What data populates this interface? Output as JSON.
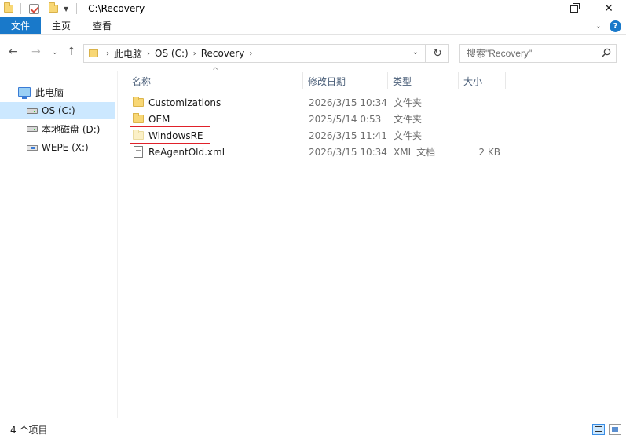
{
  "window": {
    "title": "C:\\Recovery"
  },
  "ribbon": {
    "tabs": [
      "文件",
      "主页",
      "查看"
    ]
  },
  "navigation": {
    "breadcrumb": [
      "此电脑",
      "OS (C:)",
      "Recovery"
    ],
    "search_placeholder": "搜索\"Recovery\""
  },
  "sidebar": {
    "items": [
      {
        "label": "此电脑",
        "icon": "computer-icon"
      },
      {
        "label": "OS (C:)",
        "icon": "drive-icon",
        "selected": true
      },
      {
        "label": "本地磁盘 (D:)",
        "icon": "drive-icon"
      },
      {
        "label": "WEPE (X:)",
        "icon": "usb-drive-icon"
      }
    ]
  },
  "columns": [
    "名称",
    "修改日期",
    "类型",
    "大小"
  ],
  "files": [
    {
      "name": "Customizations",
      "date": "2026/3/15 10:34",
      "type": "文件夹",
      "size": "",
      "icon": "folder-icon"
    },
    {
      "name": "OEM",
      "date": "2025/5/14 0:53",
      "type": "文件夹",
      "size": "",
      "icon": "folder-icon"
    },
    {
      "name": "WindowsRE",
      "date": "2026/3/15 11:41",
      "type": "文件夹",
      "size": "",
      "icon": "folder-icon",
      "highlighted": true
    },
    {
      "name": "ReAgentOld.xml",
      "date": "2026/3/15 10:34",
      "type": "XML 文档",
      "size": "2 KB",
      "icon": "xml-file-icon"
    }
  ],
  "status": {
    "item_count": "4 个项目"
  },
  "colors": {
    "accent": "#1979ca",
    "selection": "#cce8ff",
    "highlight_box": "#e0212a"
  }
}
